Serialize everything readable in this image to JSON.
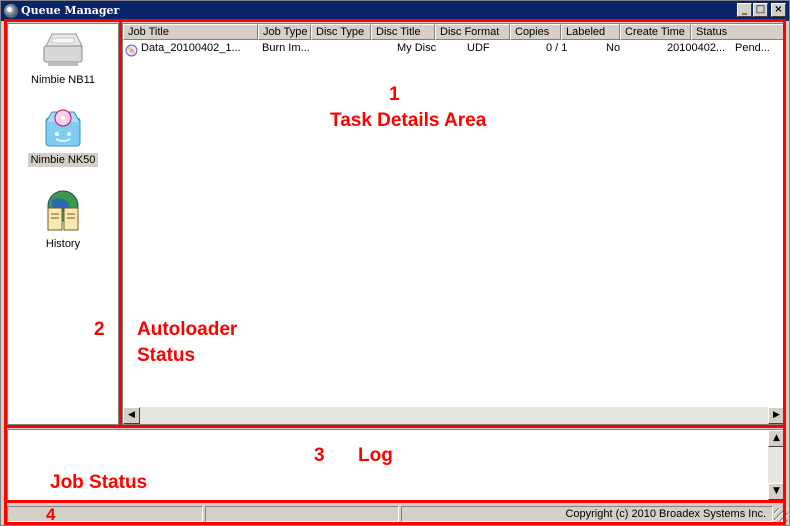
{
  "window": {
    "title": "Queue Manager",
    "min_label": "_",
    "max_label": "□",
    "close_label": "×"
  },
  "devices": [
    {
      "label": "Nimbie NB11",
      "icon": "printer-icon",
      "selected": false
    },
    {
      "label": "Nimbie NK50",
      "icon": "disc-drive-icon",
      "selected": true
    },
    {
      "label": "History",
      "icon": "history-book-icon",
      "selected": false
    }
  ],
  "table": {
    "columns": [
      "Job Title",
      "Job Type",
      "Disc Type",
      "Disc Title",
      "Disc Format",
      "Copies",
      "Labeled",
      "Create Time",
      "Status"
    ],
    "rows": [
      {
        "job_title": "Data_20100402_1...",
        "job_type": "Burn Im...",
        "disc_type": "",
        "disc_title": "My Disc",
        "disc_format": "UDF",
        "copies": "0 / 1",
        "labeled": "No",
        "create_time": "20100402...",
        "status": "Pend..."
      }
    ]
  },
  "statusbar": {
    "copyright": "Copyright (c) 2010 Broadex Systems Inc."
  },
  "annotations": {
    "task_num": "1",
    "task_label": "Task Details Area",
    "autoloader_num": "2",
    "autoloader_line1": "Autoloader",
    "autoloader_line2": "Status",
    "log_num": "3",
    "log_label": "Log",
    "job_status_label": "Job Status",
    "job_status_num": "4",
    "color": "#ff0000"
  },
  "scroll": {
    "left_arrow": "◀",
    "right_arrow": "▶",
    "up_arrow": "▲",
    "down_arrow": "▼"
  }
}
